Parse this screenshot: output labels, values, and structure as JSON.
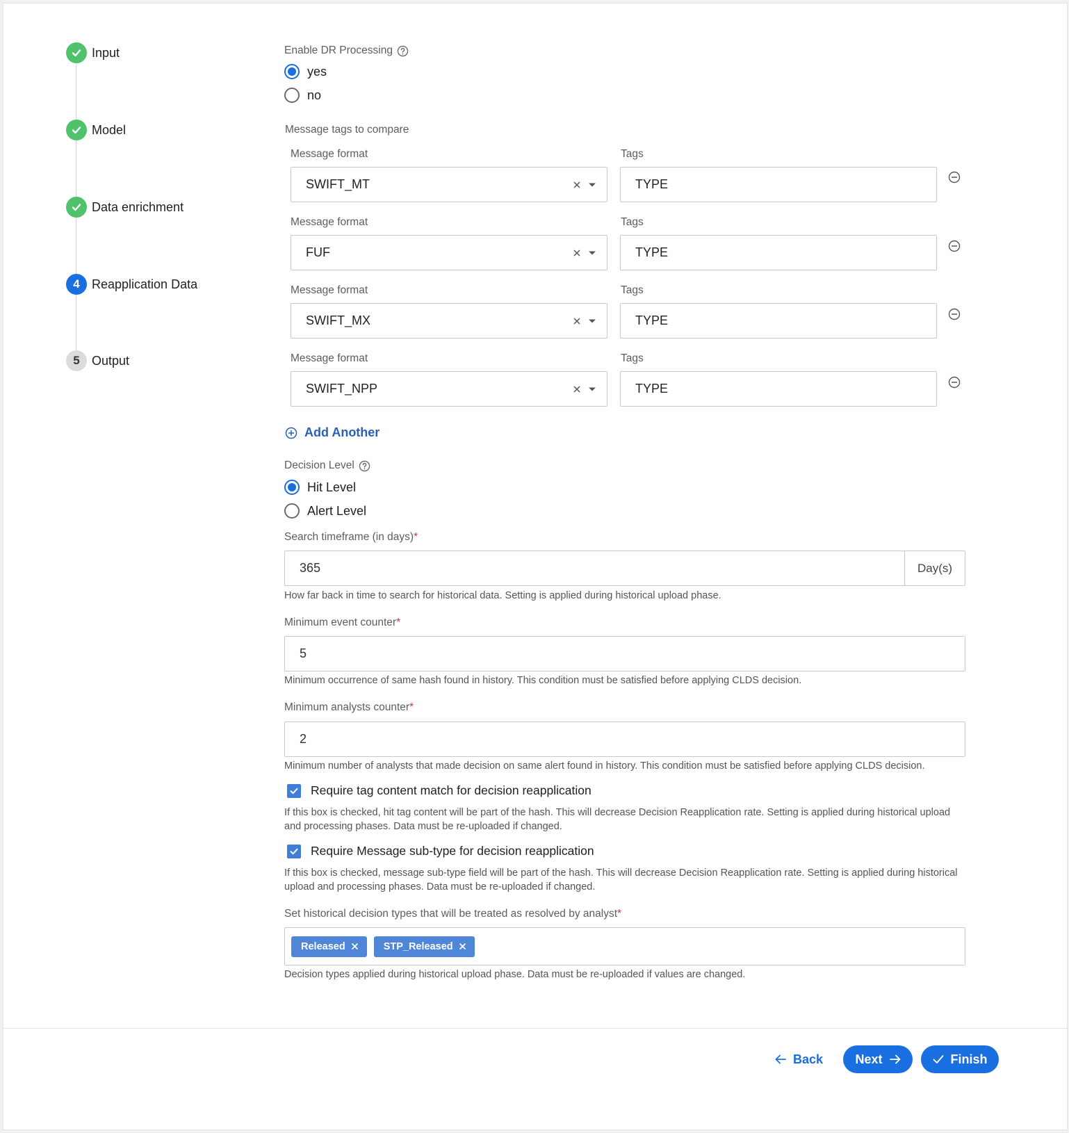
{
  "stepper": {
    "steps": [
      {
        "label": "Input",
        "marker": "",
        "state": "done",
        "icon": "check-icon"
      },
      {
        "label": "Model",
        "marker": "",
        "state": "done",
        "icon": "check-icon"
      },
      {
        "label": "Data enrichment",
        "marker": "",
        "state": "done",
        "icon": "check-icon"
      },
      {
        "label": "Reapplication Data",
        "marker": "4",
        "state": "active"
      },
      {
        "label": "Output",
        "marker": "5",
        "state": "pending"
      }
    ]
  },
  "dr_processing": {
    "label": "Enable DR Processing",
    "help_icon": "question-circle-icon",
    "options": [
      {
        "label": "yes",
        "selected": true
      },
      {
        "label": "no",
        "selected": false
      }
    ]
  },
  "message_tags": {
    "section_label": "Message tags to compare",
    "format_label": "Message format",
    "tags_label": "Tags",
    "rows": [
      {
        "format": "SWIFT_MT",
        "tags": "TYPE"
      },
      {
        "format": "FUF",
        "tags": "TYPE"
      },
      {
        "format": "SWIFT_MX",
        "tags": "TYPE"
      },
      {
        "format": "SWIFT_NPP",
        "tags": "TYPE"
      }
    ],
    "add_another_label": "Add Another"
  },
  "decision_level": {
    "label": "Decision Level",
    "help_icon": "question-circle-icon",
    "options": [
      {
        "label": "Hit Level",
        "selected": true
      },
      {
        "label": "Alert Level",
        "selected": false
      }
    ]
  },
  "search_timeframe": {
    "label": "Search timeframe (in days)",
    "required_mark": "*",
    "value": "365",
    "unit": "Day(s)",
    "helper": "How far back in time to search for historical data. Setting is applied during historical upload phase."
  },
  "min_event_counter": {
    "label": "Minimum event counter",
    "required_mark": "*",
    "value": "5",
    "helper": "Minimum occurrence of same hash found in history. This condition must be satisfied before applying CLDS decision."
  },
  "min_analysts_counter": {
    "label": "Minimum analysts counter",
    "required_mark": "*",
    "value": "2",
    "helper": "Minimum number of analysts that made decision on same alert found in history. This condition must be satisfied before applying CLDS decision."
  },
  "require_tag_content": {
    "label": "Require tag content match for decision reapplication",
    "checked": true,
    "helper_line1": "If this box is checked, hit tag content will be part of the hash. This will decrease Decision Reapplication rate. Setting is applied during historical upload",
    "helper_line2": "and processing phases. Data must be re-uploaded if changed."
  },
  "require_subtype": {
    "label": "Require Message sub-type for decision reapplication",
    "checked": true,
    "helper_line1": "If this box is checked, message sub-type field will be part of the hash. This will decrease Decision Reapplication rate. Setting is applied during historical",
    "helper_line2": "upload and processing phases. Data must be re-uploaded if changed."
  },
  "resolved_types": {
    "label": "Set historical decision types that will be treated as resolved by analyst",
    "required_mark": "*",
    "chips": [
      "Released",
      "STP_Released"
    ],
    "helper": "Decision types applied during historical upload phase. Data must be re-uploaded if values are changed."
  },
  "footer": {
    "back_label": "Back",
    "next_label": "Next",
    "finish_label": "Finish"
  },
  "colors": {
    "primary": "#1a6fe0",
    "success": "#4fc26b",
    "chip": "#4f86d8",
    "link": "#2b5fb4",
    "required": "#d0353a"
  }
}
